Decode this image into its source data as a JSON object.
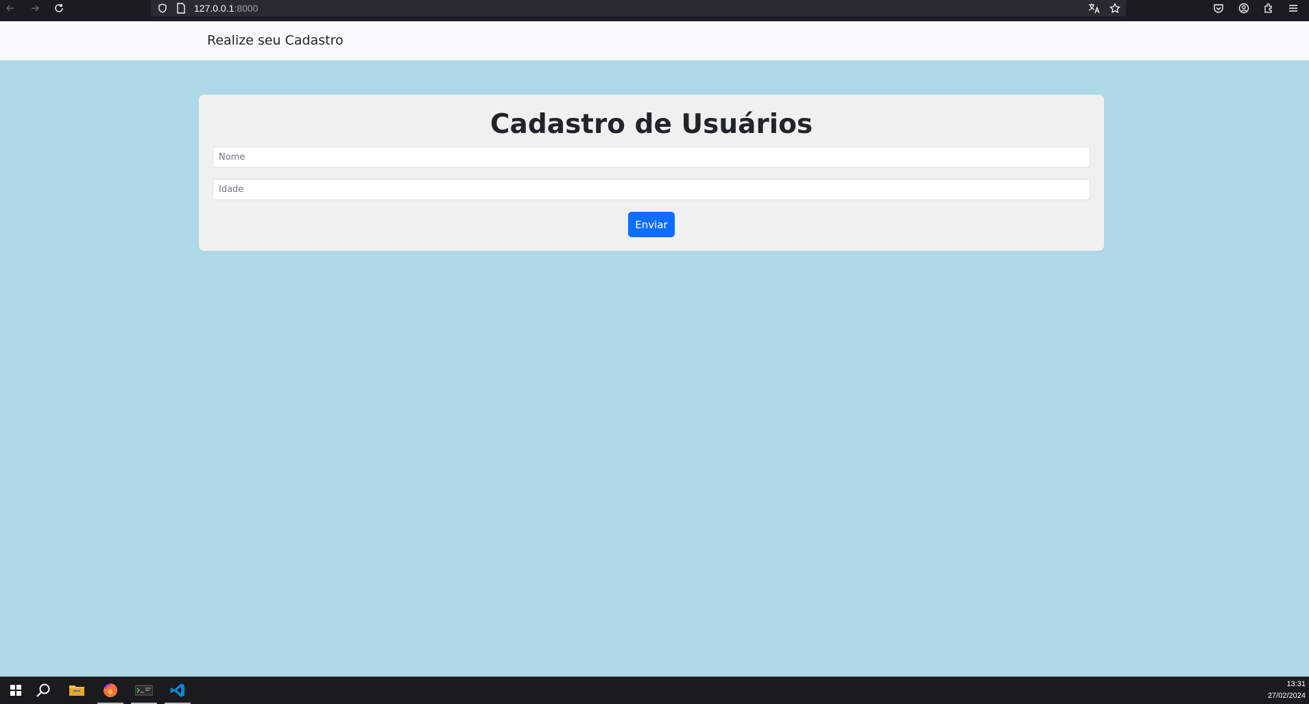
{
  "browser": {
    "url_host": "127.0.0.1",
    "url_port": ":8000"
  },
  "navbar": {
    "brand": "Realize seu Cadastro"
  },
  "form": {
    "title": "Cadastro de Usuários",
    "nome_placeholder": "Nome",
    "idade_placeholder": "Idade",
    "submit_label": "Enviar"
  },
  "taskbar": {
    "time": "13:31",
    "date": "27/02/2024"
  },
  "colors": {
    "page_background": "#add8e6",
    "navbar_background": "#f8f9fa",
    "card_background": "#f0f0f0",
    "button_primary": "#0d6efd"
  }
}
